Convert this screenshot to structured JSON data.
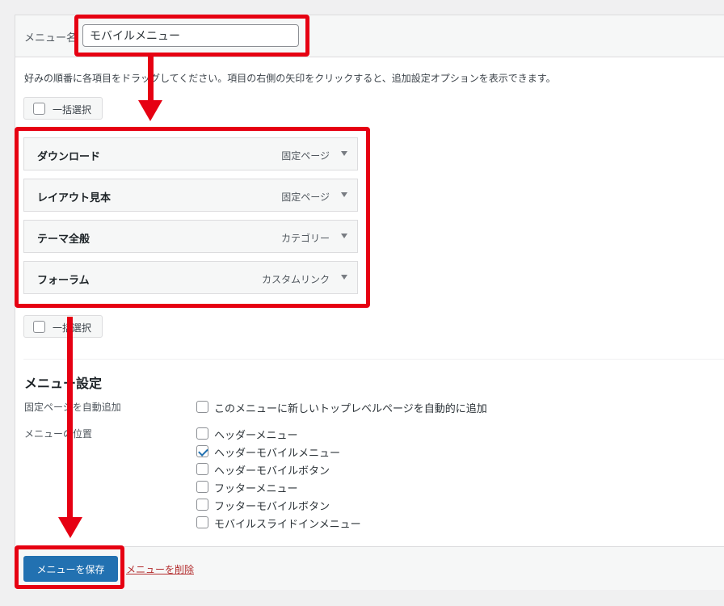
{
  "menu_name": {
    "label": "メニュー名",
    "value": "モバイルメニュー"
  },
  "instructions": "好みの順番に各項目をドラッグしてください。項目の右側の矢印をクリックすると、追加設定オプションを表示できます。",
  "bulk_select": {
    "label": "一括選択"
  },
  "menu_items": [
    {
      "title": "ダウンロード",
      "type": "固定ページ"
    },
    {
      "title": "レイアウト見本",
      "type": "固定ページ"
    },
    {
      "title": "テーマ全般",
      "type": "カテゴリー"
    },
    {
      "title": "フォーラム",
      "type": "カスタムリンク"
    }
  ],
  "menu_settings": {
    "title": "メニュー設定",
    "auto_add": {
      "label": "固定ページを自動追加",
      "option": "このメニューに新しいトップレベルページを自動的に追加",
      "checked": false
    },
    "locations": {
      "label": "メニューの位置",
      "options": [
        {
          "label": "ヘッダーメニュー",
          "checked": false
        },
        {
          "label": "ヘッダーモバイルメニュー",
          "checked": true
        },
        {
          "label": "ヘッダーモバイルボタン",
          "checked": false
        },
        {
          "label": "フッターメニュー",
          "checked": false
        },
        {
          "label": "フッターモバイルボタン",
          "checked": false
        },
        {
          "label": "モバイルスライドインメニュー",
          "checked": false
        }
      ]
    }
  },
  "footer": {
    "save_label": "メニューを保存",
    "delete_label": "メニューを削除"
  },
  "colors": {
    "primary_button": "#2271b1",
    "delete_link": "#b32d2e",
    "highlight": "#e60012"
  }
}
